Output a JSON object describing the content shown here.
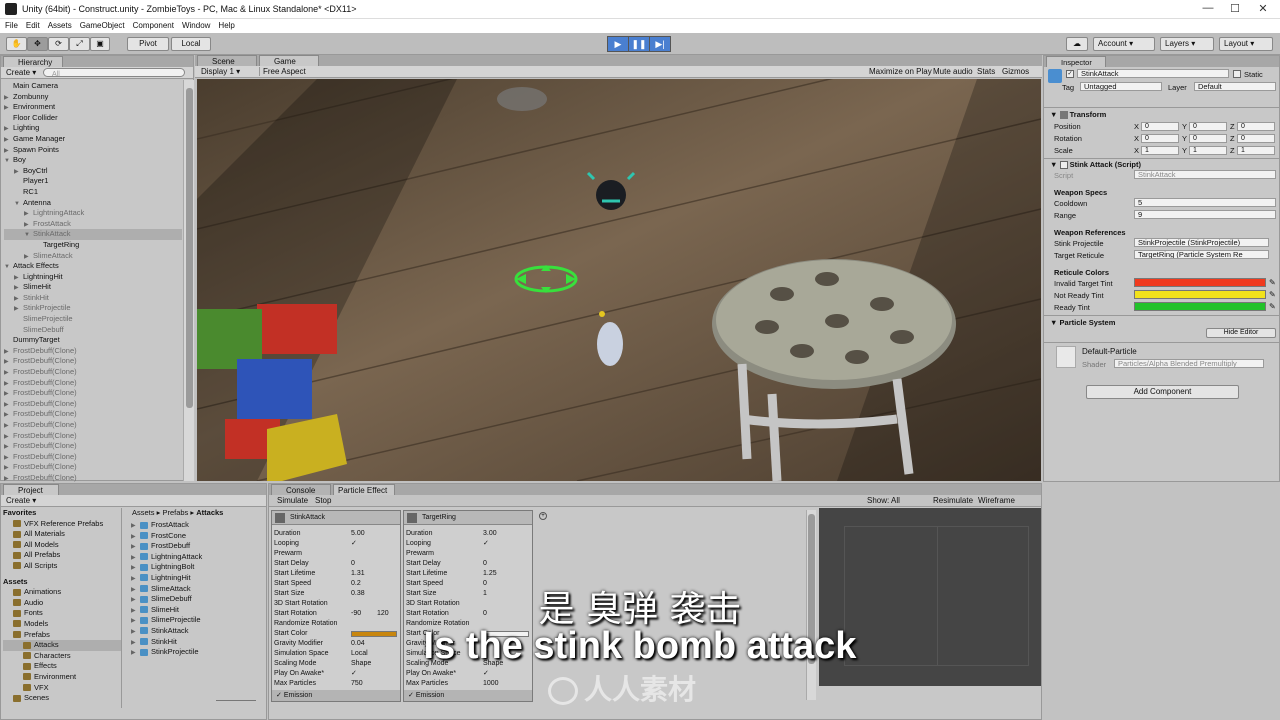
{
  "window": {
    "title": "Unity (64bit) - Construct.unity - ZombieToys - PC, Mac & Linux Standalone* <DX11>"
  },
  "menu": [
    "File",
    "Edit",
    "Assets",
    "GameObject",
    "Component",
    "Window",
    "Help"
  ],
  "toolbar": {
    "pivot": "Pivot",
    "local": "Local",
    "account": "Account",
    "layers": "Layers",
    "layout": "Layout"
  },
  "hierarchy": {
    "tab": "Hierarchy",
    "create": "Create",
    "search_placeholder": "All",
    "items": [
      {
        "label": "Main Camera",
        "depth": 0,
        "arrow": "",
        "grey": false,
        "sel": false
      },
      {
        "label": "Zombunny",
        "depth": 0,
        "arrow": "▶",
        "grey": false,
        "sel": false
      },
      {
        "label": "Environment",
        "depth": 0,
        "arrow": "▶",
        "grey": false,
        "sel": false
      },
      {
        "label": "Floor Collider",
        "depth": 0,
        "arrow": "",
        "grey": false,
        "sel": false
      },
      {
        "label": "Lighting",
        "depth": 0,
        "arrow": "▶",
        "grey": false,
        "sel": false
      },
      {
        "label": "Game Manager",
        "depth": 0,
        "arrow": "▶",
        "grey": false,
        "sel": false
      },
      {
        "label": "Spawn Points",
        "depth": 0,
        "arrow": "▶",
        "grey": false,
        "sel": false
      },
      {
        "label": "Boy",
        "depth": 0,
        "arrow": "▼",
        "grey": false,
        "sel": false
      },
      {
        "label": "BoyCtrl",
        "depth": 1,
        "arrow": "▶",
        "grey": false,
        "sel": false
      },
      {
        "label": "Player1",
        "depth": 1,
        "arrow": "",
        "grey": false,
        "sel": false
      },
      {
        "label": "RC1",
        "depth": 1,
        "arrow": "",
        "grey": false,
        "sel": false
      },
      {
        "label": "Antenna",
        "depth": 1,
        "arrow": "▼",
        "grey": false,
        "sel": false
      },
      {
        "label": "LightningAttack",
        "depth": 2,
        "arrow": "▶",
        "grey": true,
        "sel": false
      },
      {
        "label": "FrostAttack",
        "depth": 2,
        "arrow": "▶",
        "grey": true,
        "sel": false
      },
      {
        "label": "StinkAttack",
        "depth": 2,
        "arrow": "▼",
        "grey": true,
        "sel": true
      },
      {
        "label": "TargetRing",
        "depth": 3,
        "arrow": "",
        "grey": false,
        "sel": false
      },
      {
        "label": "SlimeAttack",
        "depth": 2,
        "arrow": "▶",
        "grey": true,
        "sel": false
      },
      {
        "label": "Attack Effects",
        "depth": 0,
        "arrow": "▼",
        "grey": false,
        "sel": false
      },
      {
        "label": "LightningHit",
        "depth": 1,
        "arrow": "▶",
        "grey": false,
        "sel": false
      },
      {
        "label": "SlimeHit",
        "depth": 1,
        "arrow": "▶",
        "grey": false,
        "sel": false
      },
      {
        "label": "StinkHit",
        "depth": 1,
        "arrow": "▶",
        "grey": true,
        "sel": false
      },
      {
        "label": "StinkProjectile",
        "depth": 1,
        "arrow": "▶",
        "grey": true,
        "sel": false
      },
      {
        "label": "SlimeProjectile",
        "depth": 1,
        "arrow": "",
        "grey": true,
        "sel": false
      },
      {
        "label": "SlimeDebuff",
        "depth": 1,
        "arrow": "",
        "grey": true,
        "sel": false
      },
      {
        "label": "DummyTarget",
        "depth": 0,
        "arrow": "",
        "grey": false,
        "sel": false
      },
      {
        "label": "FrostDebuff(Clone)",
        "depth": 0,
        "arrow": "▶",
        "grey": true,
        "sel": false
      },
      {
        "label": "FrostDebuff(Clone)",
        "depth": 0,
        "arrow": "▶",
        "grey": true,
        "sel": false
      },
      {
        "label": "FrostDebuff(Clone)",
        "depth": 0,
        "arrow": "▶",
        "grey": true,
        "sel": false
      },
      {
        "label": "FrostDebuff(Clone)",
        "depth": 0,
        "arrow": "▶",
        "grey": true,
        "sel": false
      },
      {
        "label": "FrostDebuff(Clone)",
        "depth": 0,
        "arrow": "▶",
        "grey": true,
        "sel": false
      },
      {
        "label": "FrostDebuff(Clone)",
        "depth": 0,
        "arrow": "▶",
        "grey": true,
        "sel": false
      },
      {
        "label": "FrostDebuff(Clone)",
        "depth": 0,
        "arrow": "▶",
        "grey": true,
        "sel": false
      },
      {
        "label": "FrostDebuff(Clone)",
        "depth": 0,
        "arrow": "▶",
        "grey": true,
        "sel": false
      },
      {
        "label": "FrostDebuff(Clone)",
        "depth": 0,
        "arrow": "▶",
        "grey": true,
        "sel": false
      },
      {
        "label": "FrostDebuff(Clone)",
        "depth": 0,
        "arrow": "▶",
        "grey": true,
        "sel": false
      },
      {
        "label": "FrostDebuff(Clone)",
        "depth": 0,
        "arrow": "▶",
        "grey": true,
        "sel": false
      },
      {
        "label": "FrostDebuff(Clone)",
        "depth": 0,
        "arrow": "▶",
        "grey": true,
        "sel": false
      },
      {
        "label": "FrostDebuff(Clone)",
        "depth": 0,
        "arrow": "▶",
        "grey": true,
        "sel": false
      }
    ]
  },
  "scene": {
    "tab_scene": "Scene",
    "tab_game": "Game",
    "display": "Display 1",
    "aspect": "Free Aspect",
    "controls": [
      "Maximize on Play",
      "Mute audio",
      "Stats",
      "Gizmos"
    ]
  },
  "inspector": {
    "tab": "Inspector",
    "object_name": "StinkAttack",
    "static_label": "Static",
    "tag_label": "Tag",
    "tag_value": "Untagged",
    "layer_label": "Layer",
    "layer_value": "Default",
    "transform": {
      "title": "Transform",
      "rows": [
        {
          "label": "Position",
          "x": "0",
          "y": "0",
          "z": "0"
        },
        {
          "label": "Rotation",
          "x": "0",
          "y": "0",
          "z": "0"
        },
        {
          "label": "Scale",
          "x": "1",
          "y": "1",
          "z": "1"
        }
      ]
    },
    "script": {
      "title": "Stink Attack (Script)",
      "script_label": "Script",
      "script_value": "StinkAttack",
      "weapon_specs": "Weapon Specs",
      "cooldown_label": "Cooldown",
      "cooldown": "5",
      "range_label": "Range",
      "range": "9",
      "weapon_refs": "Weapon References",
      "stink_proj_label": "Stink Projectile",
      "stink_proj": "StinkProjectile (StinkProjectile)",
      "target_reticule_label": "Target Reticule",
      "target_reticule": "TargetRing (Particle System Re",
      "reticule_colors": "Reticule Colors",
      "invalid_label": "Invalid Target Tint",
      "notready_label": "Not Ready Tint",
      "ready_label": "Ready Tint",
      "invalid_color": "#f03a1e",
      "notready_color": "#f2e21c",
      "ready_color": "#22c22a"
    },
    "particle_system": "Particle System",
    "hide_editor": "Hide Editor",
    "material": "Default-Particle",
    "shader_label": "Shader",
    "shader_value": "Particles/Alpha Blended Premultiply",
    "add_component": "Add Component"
  },
  "project": {
    "tab": "Project",
    "create": "Create",
    "favorites": {
      "title": "Favorites",
      "items": [
        "VFX Reference Prefabs",
        "All Materials",
        "All Models",
        "All Prefabs",
        "All Scripts"
      ]
    },
    "assets": {
      "title": "Assets",
      "items": [
        {
          "label": "Animations",
          "depth": 1
        },
        {
          "label": "Audio",
          "depth": 1
        },
        {
          "label": "Fonts",
          "depth": 1
        },
        {
          "label": "Models",
          "depth": 1
        },
        {
          "label": "Prefabs",
          "depth": 1
        },
        {
          "label": "Attacks",
          "depth": 2
        },
        {
          "label": "Characters",
          "depth": 2
        },
        {
          "label": "Effects",
          "depth": 2
        },
        {
          "label": "Environment",
          "depth": 2
        },
        {
          "label": "VFX",
          "depth": 2
        },
        {
          "label": "Scenes",
          "depth": 1
        }
      ]
    },
    "breadcrumb": [
      "Assets",
      "Prefabs",
      "Attacks"
    ],
    "files": [
      "FrostAttack",
      "FrostCone",
      "FrostDebuff",
      "LightningAttack",
      "LightningBolt",
      "LightningHit",
      "SlimeAttack",
      "SlimeDebuff",
      "SlimeHit",
      "SlimeProjectile",
      "StinkAttack",
      "StinkHit",
      "StinkProjectile"
    ]
  },
  "particle": {
    "tab_console": "Console",
    "tab_particle": "Particle Effect",
    "simulate": "Simulate",
    "stop": "Stop",
    "show": "Show: All",
    "resimulate": "Resimulate",
    "wireframe": "Wireframe",
    "labels": [
      "Duration",
      "Looping",
      "Prewarm",
      "Start Delay",
      "Start Lifetime",
      "Start Speed",
      "Start Size",
      "3D Start Rotation",
      "Start Rotation",
      "Randomize Rotation",
      "Start Color",
      "Gravity Modifier",
      "Simulation Space",
      "Scaling Mode",
      "Play On Awake*",
      "Max Particles"
    ],
    "labels_b": [
      "Duration",
      "Looping",
      "Prewarm",
      "Start Delay",
      "Start Lifetime",
      "Start Speed",
      "Start Size",
      "3D Start Rotation",
      "Start Rotation",
      "Randomize Rotation",
      "Start Color",
      "Gravity Modifier",
      "Simulation Space",
      "Scaling Mode",
      "Play On Awake*",
      "Max Particles"
    ],
    "sys_a": {
      "name": "StinkAttack",
      "values": [
        "5.00",
        "✓",
        "",
        "0",
        "1.31",
        "0.2",
        "0.38",
        "",
        "-90",
        "",
        "",
        "0.04",
        "Local",
        "Shape",
        "✓",
        "750"
      ],
      "rot2": "120",
      "emission": "Emission"
    },
    "sys_b": {
      "name": "TargetRing",
      "values": [
        "3.00",
        "✓",
        "",
        "0",
        "1.25",
        "0",
        "1",
        "",
        "0",
        "",
        "",
        "0",
        "",
        "Shape",
        "✓",
        "1000"
      ],
      "emission": "Emission"
    }
  },
  "subtitles": {
    "zh": "是 臭弹 袭击",
    "en": "Is the stink bomb attack"
  },
  "watermark": "人人素材"
}
